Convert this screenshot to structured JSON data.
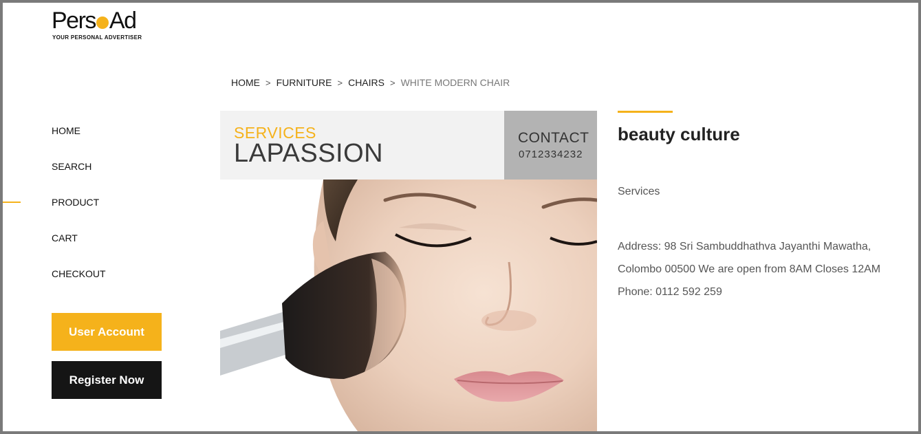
{
  "logo": {
    "name_start": "Pers",
    "name_end": "Ad",
    "tagline": "YOUR PERSONAL ADVERTISER"
  },
  "nav": {
    "items": [
      {
        "label": "HOME"
      },
      {
        "label": "SEARCH"
      },
      {
        "label": "PRODUCT"
      },
      {
        "label": "CART"
      },
      {
        "label": "CHECKOUT"
      }
    ],
    "active": "PRODUCT"
  },
  "buttons": {
    "account": "User Account",
    "register": "Register Now"
  },
  "breadcrumb": {
    "items": [
      "HOME",
      "FURNITURE",
      "CHAIRS"
    ],
    "current": "WHITE MODERN CHAIR",
    "separator": ">"
  },
  "banner": {
    "services": "SERVICES",
    "brand": "LAPASSION",
    "contact_label": "CONTACT",
    "contact_phone": "0712334232"
  },
  "product": {
    "title": "beauty culture",
    "category": "Services",
    "description": "Address: 98 Sri Sambuddhathva Jayanthi Mawatha, Colombo 00500 We are open from 8AM Closes 12AM Phone: 0112 592 259"
  },
  "colors": {
    "accent": "#f5b21b",
    "dark_button": "#151515",
    "frame": "#7a7a7a"
  }
}
